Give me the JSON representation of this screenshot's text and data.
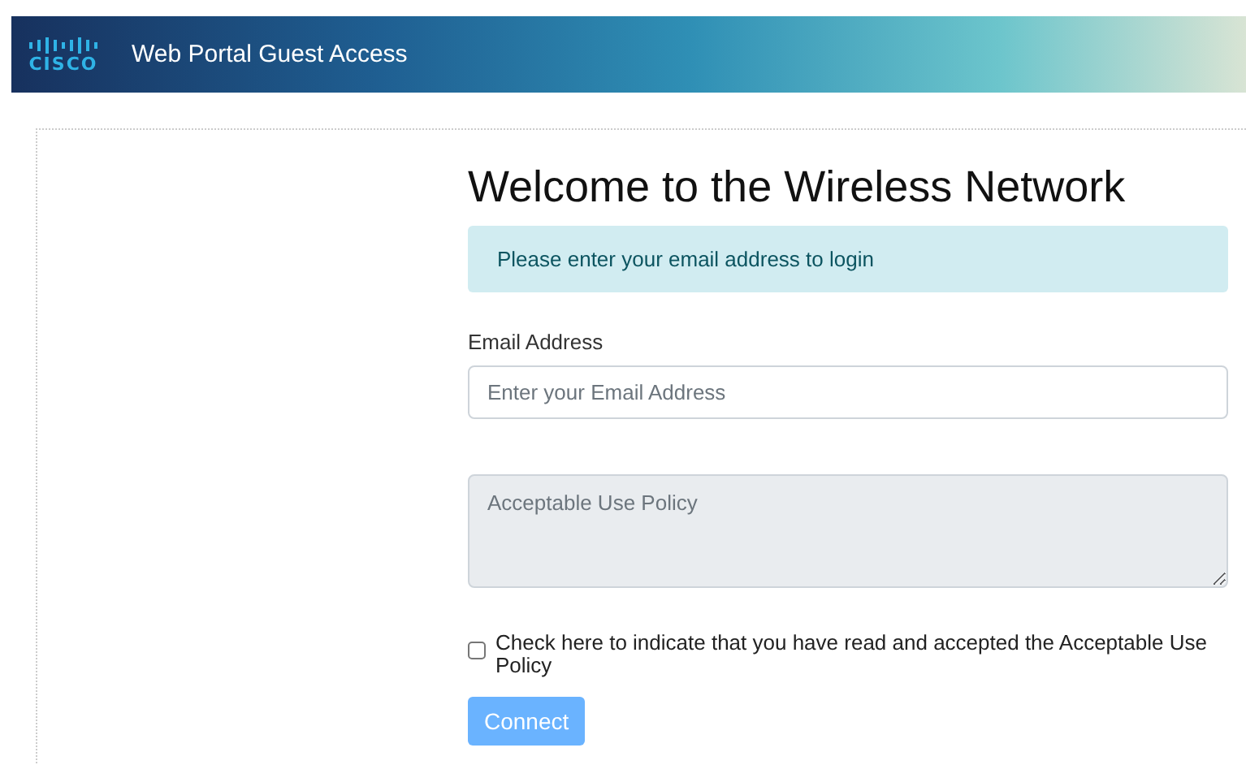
{
  "header": {
    "logo_text": "CISCO",
    "title": "Web Portal Guest Access"
  },
  "form": {
    "heading": "Welcome to the Wireless Network",
    "alert": "Please enter your email address to login",
    "email": {
      "label": "Email Address",
      "placeholder": "Enter your Email Address"
    },
    "policy": {
      "placeholder": "Acceptable Use Policy"
    },
    "accept": {
      "label": "Check here to indicate that you have read and accepted the Acceptable Use Policy",
      "checked": false
    },
    "connect": {
      "label": "Connect",
      "disabled": true
    }
  }
}
